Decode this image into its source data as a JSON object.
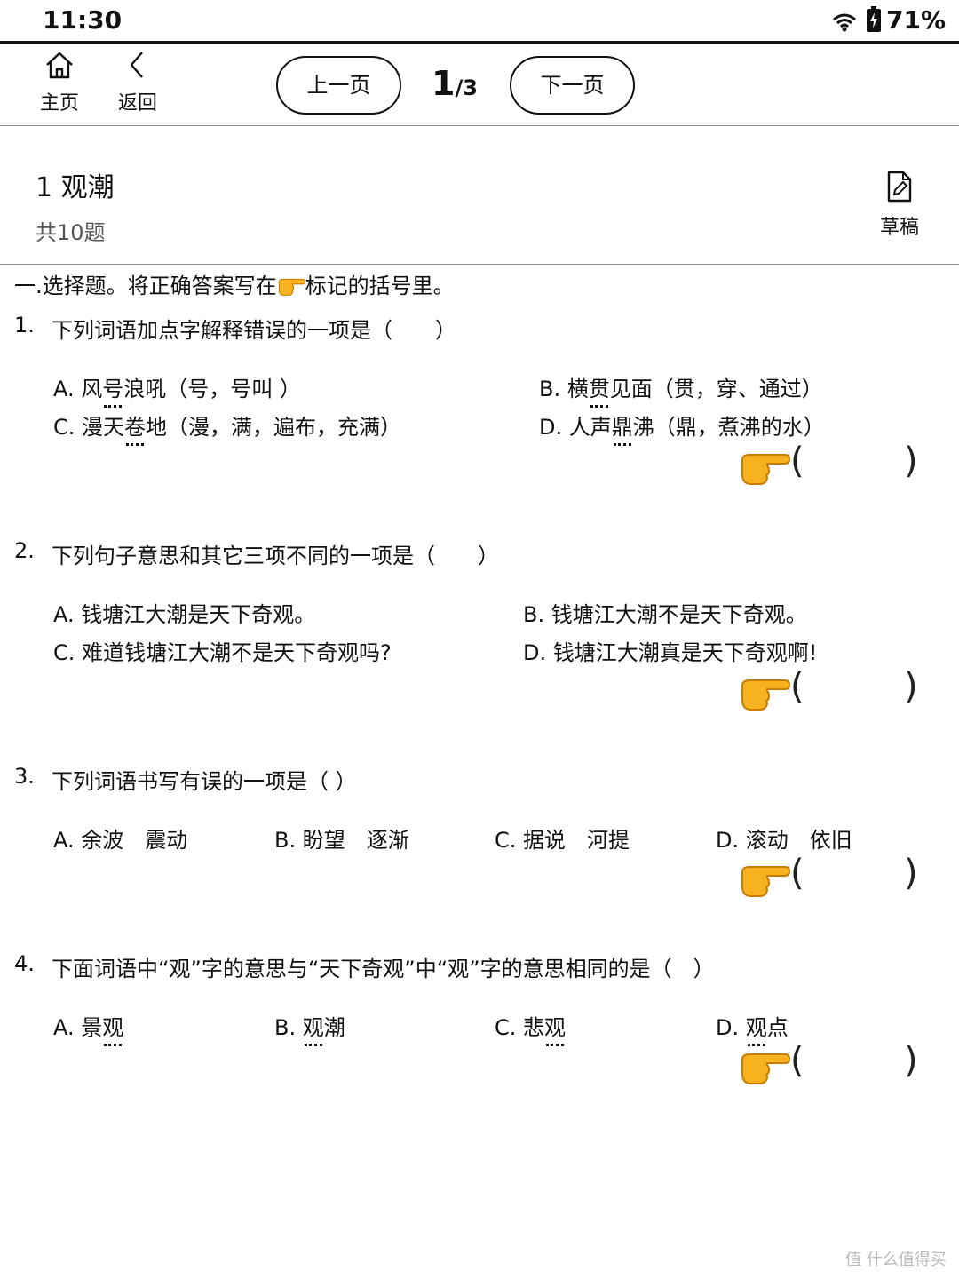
{
  "status": {
    "time": "11:30",
    "battery": "71%"
  },
  "nav": {
    "home_label": "主页",
    "back_label": "返回",
    "prev_label": "上一页",
    "next_label": "下一页",
    "page_current": "1",
    "page_total": "/3"
  },
  "header": {
    "title": "1 观潮",
    "count": "共10题",
    "draft_label": "草稿"
  },
  "section": {
    "instruction_pre": "一.选择题。将正确答案写在",
    "instruction_post": "标记的括号里。"
  },
  "questions": [
    {
      "num": "1.",
      "stem": "下列词语加点字解释错误的一项是（　　）",
      "options": {
        "a_pre": "A. 风",
        "a_dot": "号",
        "a_post": "浪吼（号，号叫 ）",
        "b_pre": "B. 横",
        "b_dot": "贯",
        "b_post": "见面（贯，穿、通过）",
        "c_pre": "C. 漫天",
        "c_dot": "卷",
        "c_post": "地（漫，满，遍布，充满）",
        "d_pre": "D. 人声",
        "d_dot": "鼎",
        "d_post": "沸（鼎，煮沸的水）"
      }
    },
    {
      "num": "2.",
      "stem": "下列句子意思和其它三项不同的一项是（　　）",
      "options": {
        "a": "A. 钱塘江大潮是天下奇观。",
        "b": "B. 钱塘江大潮不是天下奇观。",
        "c": "C. 难道钱塘江大潮不是天下奇观吗?",
        "d": "D. 钱塘江大潮真是天下奇观啊!"
      }
    },
    {
      "num": "3.",
      "stem": "下列词语书写有误的一项是（ ）",
      "options": {
        "a": "A. 余波　震动",
        "b": "B. 盼望　逐渐",
        "c": "C. 据说　河提",
        "d": "D. 滚动　依旧"
      }
    },
    {
      "num": "4.",
      "stem": "下面词语中“观”字的意思与“天下奇观”中“观”字的意思相同的是（　）",
      "options": {
        "a_pre": "A. 景",
        "a_dot": "观",
        "b_pre": "B. ",
        "b_dot": "观",
        "b_post": "潮",
        "c_pre": "C. 悲",
        "c_dot": "观",
        "d_pre": "D. ",
        "d_dot": "观",
        "d_post": "点"
      }
    }
  ],
  "answer": {
    "open": "(",
    "close": ")"
  },
  "watermark": "值 什么值得买"
}
